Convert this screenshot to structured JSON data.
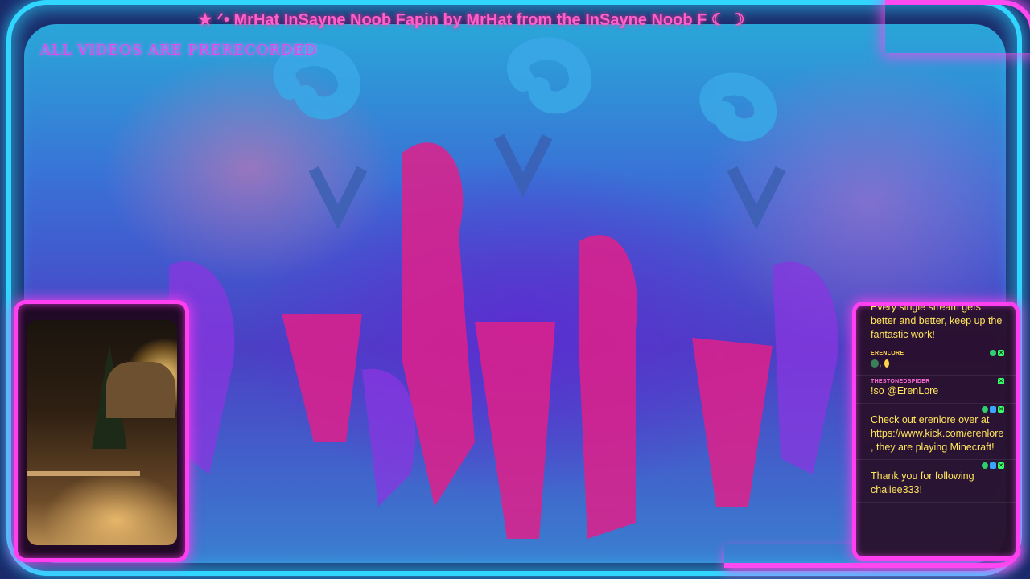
{
  "ticker": "★ ᐟ• MrHat InSayne Noob Fapin by MrHat from the InSayne Noob F ☾ ☽",
  "notice": "ALL VIDEOS ARE PRERECORDED",
  "chat": {
    "messages": [
      {
        "user": "",
        "text": "Every single stream gets better and better, keep up the fantastic work!",
        "user_color": "#ffffff"
      },
      {
        "user": "ERENLORE",
        "text": ",",
        "user_color": "#ffd84a",
        "emotes": true
      },
      {
        "user": "THESTONEDSPIDER",
        "text": "!so @ErenLore",
        "user_color": "#ff6bd6"
      },
      {
        "user": "",
        "text": "Check out erenlore over at https://www.kick.com/erenlore , they are playing Minecraft!",
        "user_color": "#ff3030"
      },
      {
        "user": "",
        "text": "Thank you for following chaliee333!",
        "user_color": "#ff3030"
      }
    ]
  },
  "colors": {
    "neon_blue": "#31d6ff",
    "neon_pink": "#ff3ff0",
    "chat_text": "#ffe45c"
  }
}
